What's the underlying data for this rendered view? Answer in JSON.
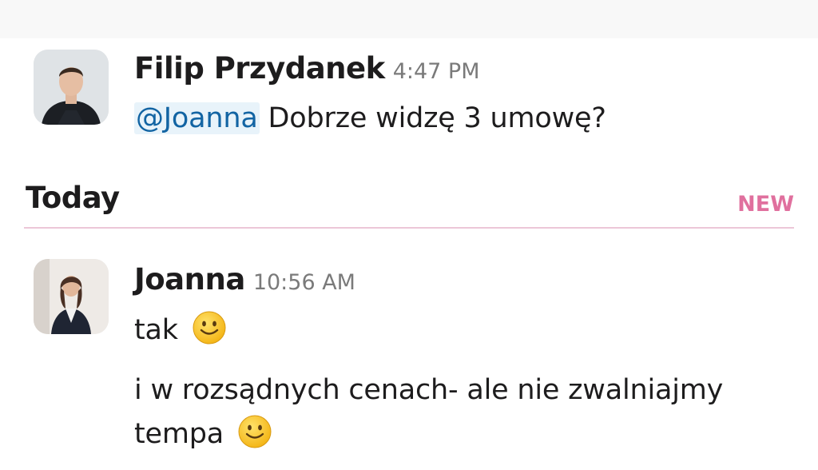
{
  "messages": [
    {
      "author": "Filip Przydanek",
      "time": "4:47 PM",
      "mention": "@Joanna",
      "text": "Dobrze widzę 3 umowę?"
    },
    {
      "author": "Joanna",
      "time": "10:56 AM",
      "lines": [
        "tak",
        "i w rozsądnych cenach- ale nie zwalniajmy",
        "tempa"
      ]
    }
  ],
  "divider": {
    "label": "Today",
    "new_label": "NEW"
  },
  "colors": {
    "mention": "#1264a3",
    "mention_bg": "#e8f3fa",
    "new": "#e0709e",
    "divider_line": "#ecc7d8",
    "timestamp": "#7a7a7a"
  },
  "icons": {
    "emoji": "slightly-smiling-face-icon"
  }
}
